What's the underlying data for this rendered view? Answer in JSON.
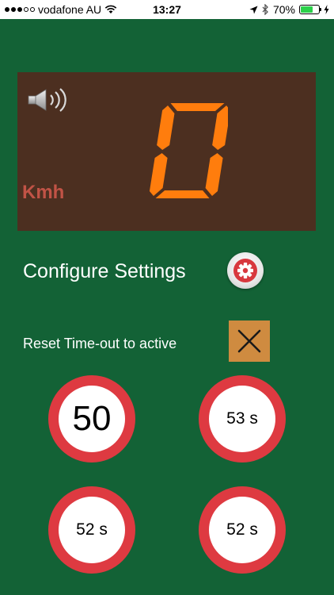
{
  "status_bar": {
    "carrier": "vodafone AU",
    "time": "13:27",
    "battery_percent": "70%",
    "battery_level": 0.7
  },
  "speedometer": {
    "speed_value": "0",
    "unit": "Kmh",
    "digit_color": "#ff7d0d",
    "panel_color": "#4c2f20"
  },
  "settings": {
    "configure_label": "Configure Settings",
    "reset_timeout_label": "Reset Time-out to active"
  },
  "speed_signs": [
    {
      "label": "50"
    },
    {
      "label": "53 s"
    },
    {
      "label": "52 s"
    },
    {
      "label": "52 s"
    }
  ],
  "colors": {
    "background": "#136236",
    "sign_ring": "#de3a41",
    "close_button": "#cf8b40"
  },
  "icons": [
    "speaker-icon",
    "gear-icon",
    "close-icon",
    "wifi-icon",
    "location-icon",
    "bluetooth-icon",
    "battery-icon",
    "charging-icon"
  ]
}
